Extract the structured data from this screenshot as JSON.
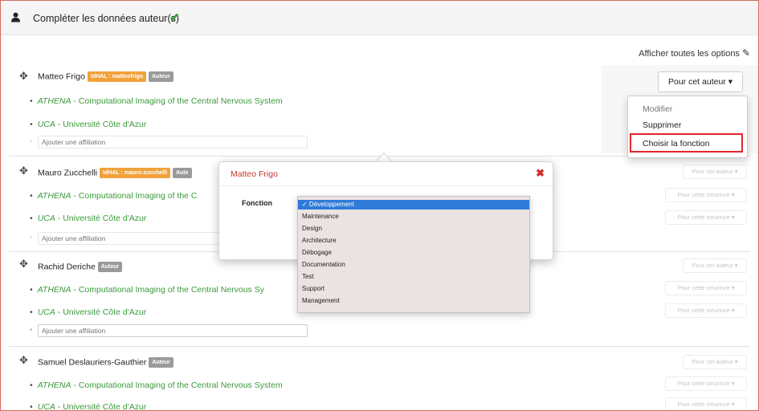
{
  "header": {
    "title": "Compléter les données auteur(s)"
  },
  "show_options": "Afficher toutes les options",
  "authors": [
    {
      "name": "Matteo Frigo",
      "idhal_badge": "IdHAL : matteofrigo",
      "role_badge": "Auteur",
      "affiliations": [
        {
          "acronym": "ATHENA",
          "rest": "Computational Imaging of the Central Nervous System"
        },
        {
          "acronym": "UCA",
          "rest": "Université Côte d'Azur"
        }
      ],
      "add_affiliation_placeholder": "Ajouter une affiliation"
    },
    {
      "name": "Mauro Zucchelli",
      "idhal_badge": "IdHAL : mauro-zucchelli",
      "role_badge": "Aute",
      "affiliations": [
        {
          "acronym": "ATHENA",
          "rest": "Computational Imaging of the C"
        },
        {
          "acronym": "UCA",
          "rest": "Université Côte d'Azur"
        }
      ],
      "add_affiliation_placeholder": "Ajouter une affiliation"
    },
    {
      "name": "Rachid Deriche",
      "role_badge": "Auteur",
      "affiliations": [
        {
          "acronym": "ATHENA",
          "rest": "Computational Imaging of the Central Nervous Sy"
        },
        {
          "acronym": "UCA",
          "rest": "Université Côte d'Azur"
        }
      ],
      "add_affiliation_placeholder": "Ajouter une affiliation"
    },
    {
      "name": "Samuel Deslauriers-Gauthier",
      "role_badge": "Auteur",
      "affiliations": [
        {
          "acronym": "ATHENA",
          "rest": "Computational Imaging of the Central Nervous System"
        },
        {
          "acronym": "UCA",
          "rest": "Université Côte d'Azur"
        }
      ]
    }
  ],
  "buttons": {
    "pour_cet_auteur": "Pour cet auteur ▾",
    "pour_cette_structure": "Pour cette structure ▾"
  },
  "author_menu": {
    "items": [
      "Modifier",
      "Supprimer",
      "Choisir la fonction"
    ],
    "highlighted": "Choisir la fonction"
  },
  "modal": {
    "title": "Matteo Frigo",
    "close": "✖",
    "field_label": "Fonction",
    "options": [
      "✓ Développement",
      "Maintenance",
      "Design",
      "Architecture",
      "Débogage",
      "Documentation",
      "Test",
      "Support",
      "Management"
    ],
    "selected": "Développement"
  },
  "colors": {
    "affiliation_green": "#3c9a3c",
    "idhal_orange": "#f0a23a",
    "highlight_red": "#e0252d",
    "selected_blue": "#2f7bd8",
    "modal_title_red": "#c0392b"
  },
  "icons": {
    "header": "user-icon",
    "header_status": "check-icon",
    "drag": "drag-handle-icon",
    "edit": "edit-icon",
    "close": "close-icon"
  }
}
